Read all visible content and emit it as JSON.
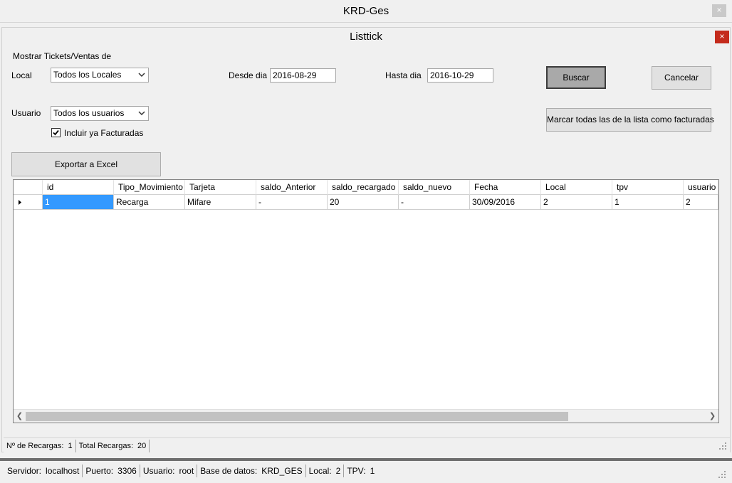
{
  "app": {
    "title": "KRD-Ges",
    "close_label": "×"
  },
  "dialog": {
    "title": "Listtick",
    "close_label": "×"
  },
  "filters": {
    "group_label": "Mostrar Tickets/Ventas de",
    "local_label": "Local",
    "local_value": "Todos los Locales",
    "desde_label": "Desde dia",
    "desde_value": "2016-08-29",
    "hasta_label": "Hasta dia",
    "hasta_value": "2016-10-29",
    "usuario_label": "Usuario",
    "usuario_value": "Todos los usuarios",
    "incluir_label": "Incluir ya Facturadas",
    "incluir_checked": true
  },
  "buttons": {
    "buscar": "Buscar",
    "cancelar": "Cancelar",
    "marcar": "Marcar todas las de la lista como facturadas",
    "exportar": "Exportar a Excel"
  },
  "table": {
    "columns": [
      "id",
      "Tipo_Movimiento",
      "Tarjeta",
      "saldo_Anterior",
      "saldo_recargado",
      "saldo_nuevo",
      "Fecha",
      "Local",
      "tpv",
      "usuario"
    ],
    "rows": [
      [
        "1",
        "Recarga",
        "Mifare",
        "-",
        "20",
        "-",
        "30/09/2016",
        "2",
        "1",
        "2"
      ]
    ]
  },
  "dialog_status": {
    "recargas_label": "Nº de Recargas:",
    "recargas_value": "1",
    "total_label": "Total Recargas:",
    "total_value": "20"
  },
  "app_status": {
    "servidor_label": "Servidor:",
    "servidor_value": "localhost",
    "puerto_label": "Puerto:",
    "puerto_value": "3306",
    "usuario_label": "Usuario:",
    "usuario_value": "root",
    "bd_label": "Base de datos:",
    "bd_value": "KRD_GES",
    "local_label": "Local:",
    "local_value": "2",
    "tpv_label": "TPV:",
    "tpv_value": "1"
  },
  "icons": {
    "close": "close-icon",
    "dropdown": "chevron-down-icon",
    "row_pointer": "row-pointer-icon",
    "check": "check-icon",
    "grip": "resize-grip-icon"
  }
}
